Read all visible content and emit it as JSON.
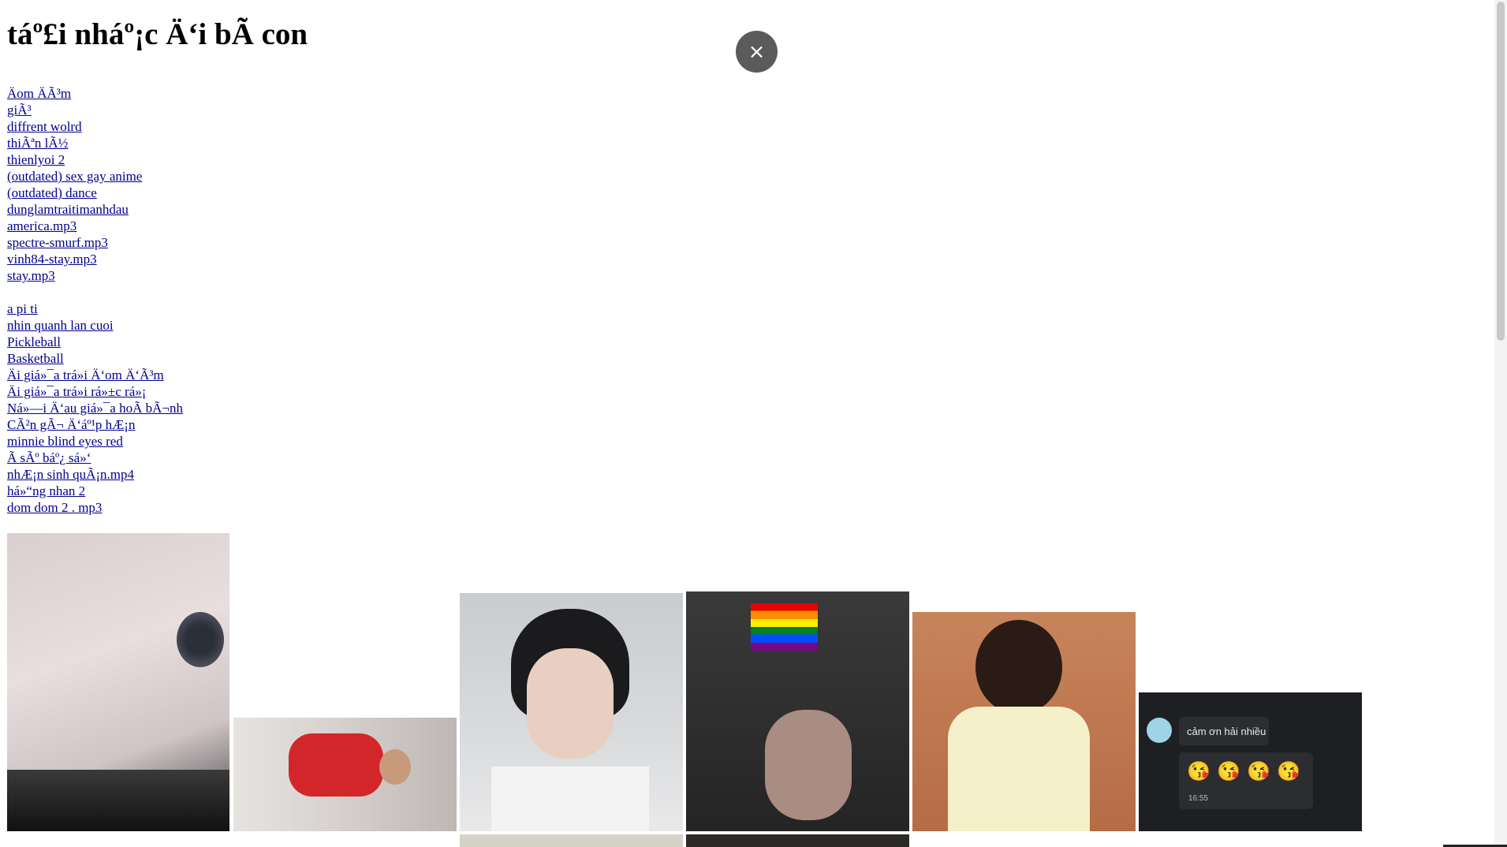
{
  "page": {
    "title": "táº£i nháº¡c Ä‘i bÃ  con",
    "close_icon": "×"
  },
  "links_group_1": [
    "Äom ÄÃ³m",
    "giÃ³",
    "diffrent wolrd",
    "thiÃªn lÃ½",
    "thienlyoi 2",
    "(outdated) sex gay anime",
    "(outdated) dance",
    "dunglamtraitimanhdau",
    "america.mp3",
    "spectre-smurf.mp3",
    "vinh84-stay.mp3",
    "stay.mp3"
  ],
  "links_group_2": [
    "a pi ti",
    "nhin quanh lan cuoi",
    "Pickleball",
    "Basketball",
    "Äi giá»¯a trá»i Ä‘om Ä‘Ã³m",
    "Äi giá»¯a trá»i rá»±c rá»¡",
    "Ná»—i Ä‘au giá»¯a hoÃ  bÃ¬nh",
    "CÃ²n gÃ¬ Ä‘áº¹p hÆ¡n",
    "minnie blind eyes red",
    "Ã  sÃº báº¿ sá»‘",
    "nhÆ¡n sinh quÃ¡n.mp4",
    "há»“ng nhan 2",
    "dom dom 2 . mp3"
  ],
  "chat_card": {
    "message": "cảm ơn hải nhiều",
    "time": "16:55",
    "emoji": "😘"
  },
  "images": [
    {
      "name": "nose-closeup-photo"
    },
    {
      "name": "red-shirt-photo"
    },
    {
      "name": "bandage-finger-photo"
    },
    {
      "name": "rainbow-flag-photo"
    },
    {
      "name": "boy-yellow-shirt-photo"
    },
    {
      "name": "chat-screenshot"
    }
  ]
}
